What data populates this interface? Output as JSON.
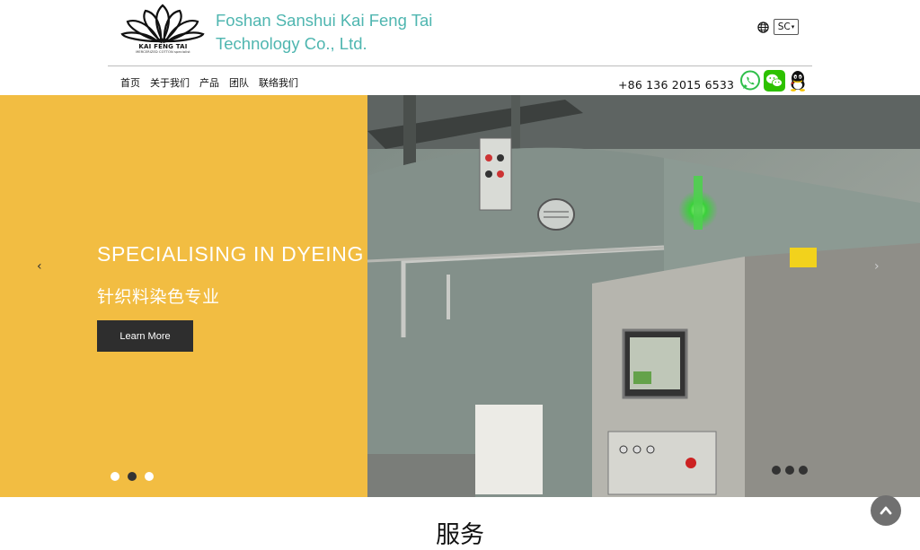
{
  "header": {
    "logo_brand": "KAI FENG TAI",
    "logo_tagline": "MERCERIZED COTTON specialist",
    "company_line1": "Foshan Sanshui Kai Feng Tai",
    "company_line2": "Technology Co., Ltd.",
    "language": "SC",
    "nav": [
      "首页",
      "关于我们",
      "产品",
      "团队",
      "联络我们"
    ],
    "phone": "+86 136 2015 6533",
    "icons": [
      "globe-icon",
      "whatsapp-icon",
      "wechat-icon",
      "qq-icon"
    ],
    "brand_color": "#4fb6b0"
  },
  "hero": {
    "title": "SPECIALISING IN DYEING",
    "subtitle": "针织料染色专业",
    "button": "Learn More",
    "prev_glyph": "‹",
    "next_glyph": "›",
    "slides": 3,
    "active_slide": 2,
    "panel_color": "#f2bd42"
  },
  "section": {
    "title": "服务"
  },
  "back_to_top_glyph": "⌃"
}
